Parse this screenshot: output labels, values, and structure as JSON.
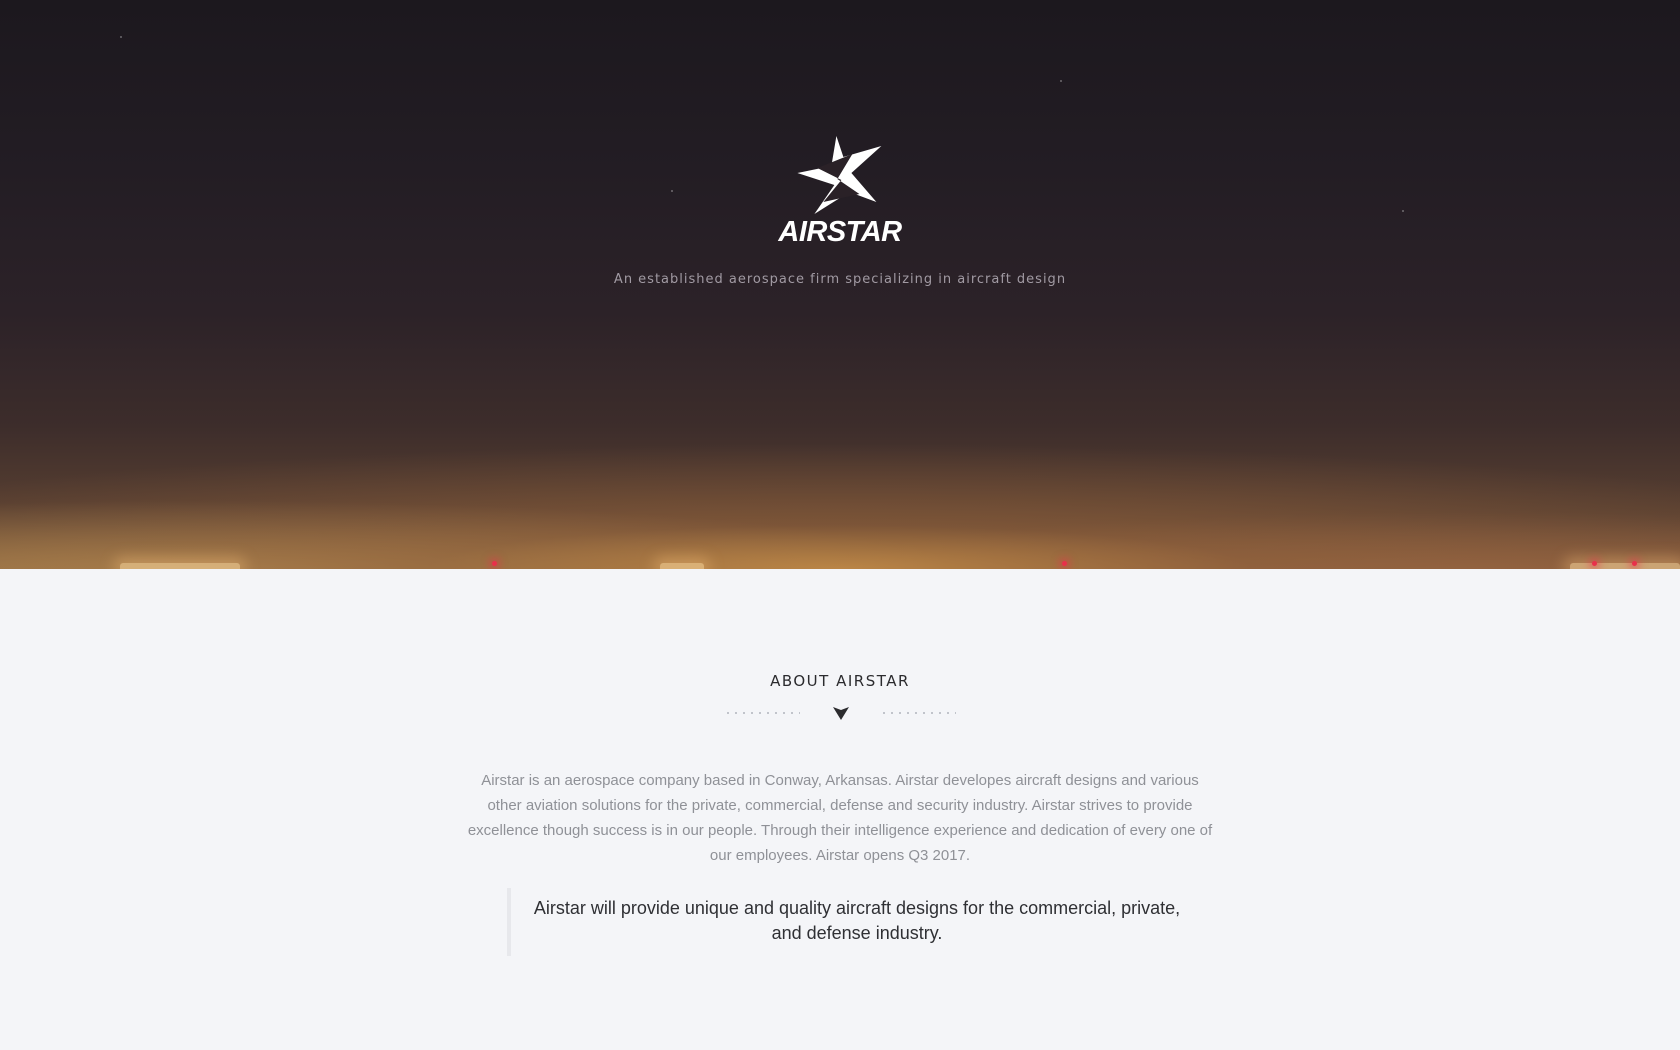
{
  "colors": {
    "hero_top": "#1c181e",
    "hero_bottom": "#7a5636",
    "page_background": "#f4f5f8",
    "heading_text": "#2b2b2e",
    "body_text": "#8f9197",
    "tagline_text": "#a19aa3",
    "runway_light": "#e8304a"
  },
  "hero": {
    "logo_icon": "airstar-star-logo-icon",
    "logo_text": "AIRSTAR",
    "tagline": "An established aerospace firm specializing in aircraft design"
  },
  "about": {
    "title": "ABOUT AIRSTAR",
    "divider_icon": "down-arrow-icon",
    "body": "Airstar is an aerospace company based in Conway, Arkansas. Airstar developes aircraft designs and various other aviation solutions for the private, commercial, defense and security industry. Airstar strives to provide excellence though success is in our people. Through their intelligence experience and dedication of every one of our employees. Airstar opens Q3 2017.",
    "quote": "Airstar will provide unique and quality aircraft designs for the commercial, private, and defense industry."
  }
}
